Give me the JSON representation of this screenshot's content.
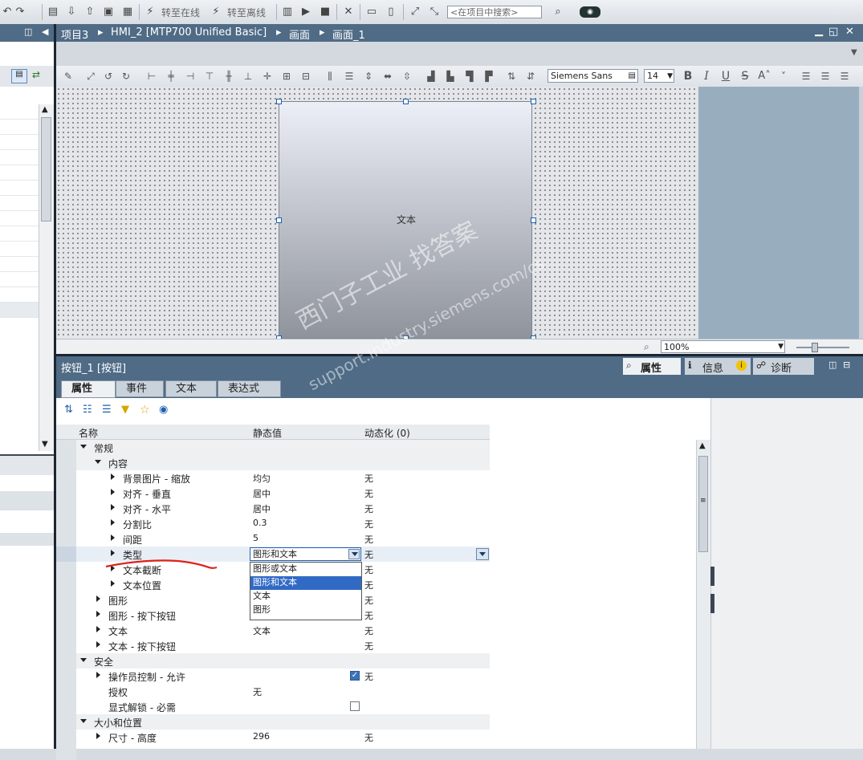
{
  "toolbar": {
    "go_online": "转至在线",
    "go_offline": "转至离线",
    "search_placeholder": "<在项目中搜索>"
  },
  "breadcrumb": [
    "项目3",
    "HMI_2 [MTP700 Unified Basic]",
    "画面",
    "画面_1"
  ],
  "editor_toolbar": {
    "font": "Siemens Sans",
    "font_size": "14",
    "bold": "B",
    "italic": "I",
    "underline": "U",
    "strike": "S"
  },
  "canvas": {
    "button_text": "文本",
    "zoom": "100%"
  },
  "properties": {
    "title": "按钮_1 [按钮]",
    "right_tabs": [
      "属性",
      "信息",
      "诊断"
    ],
    "tabs": [
      "属性",
      "事件",
      "文本",
      "表达式"
    ],
    "columns": [
      "名称",
      "静态值",
      "动态化 (0)"
    ],
    "rows": [
      {
        "name": "常规",
        "value": "",
        "dyn": ""
      },
      {
        "name": "内容",
        "value": "",
        "dyn": ""
      },
      {
        "name": "背景图片 - 缩放",
        "value": "均匀",
        "dyn": "无"
      },
      {
        "name": "对齐 - 垂直",
        "value": "居中",
        "dyn": "无"
      },
      {
        "name": "对齐 - 水平",
        "value": "居中",
        "dyn": "无"
      },
      {
        "name": "分割比",
        "value": "0.3",
        "dyn": "无"
      },
      {
        "name": "间距",
        "value": "5",
        "dyn": "无"
      },
      {
        "name": "类型",
        "value": "图形和文本",
        "dyn": "无"
      },
      {
        "name": "文本截断",
        "value": "",
        "dyn": "无"
      },
      {
        "name": "文本位置",
        "value": "",
        "dyn": "无"
      },
      {
        "name": "图形",
        "value": "",
        "dyn": "无"
      },
      {
        "name": "图形 - 按下按钮",
        "value": "",
        "dyn": "无"
      },
      {
        "name": "文本",
        "value": "文本",
        "dyn": "无"
      },
      {
        "name": "文本 - 按下按钮",
        "value": "",
        "dyn": "无"
      },
      {
        "name": "安全",
        "value": "",
        "dyn": ""
      },
      {
        "name": "操作员控制 - 允许",
        "value": "",
        "dyn": "无"
      },
      {
        "name": "授权",
        "value": "无",
        "dyn": ""
      },
      {
        "name": "显式解锁 - 必需",
        "value": "",
        "dyn": ""
      },
      {
        "name": "大小和位置",
        "value": "",
        "dyn": ""
      },
      {
        "name": "尺寸 - 高度",
        "value": "296",
        "dyn": "无"
      }
    ],
    "type_options": [
      "图形或文本",
      "图形和文本",
      "文本",
      "图形"
    ],
    "operator_control_allowed": true,
    "explicit_unlock_required": false
  },
  "watermark": {
    "line1": "西门子工业   找答案",
    "line2": "support.industry.siemens.com/cs"
  },
  "colors": {
    "accent": "#4f6b86",
    "selection": "#316ac5",
    "annotation": "#e0201a"
  }
}
